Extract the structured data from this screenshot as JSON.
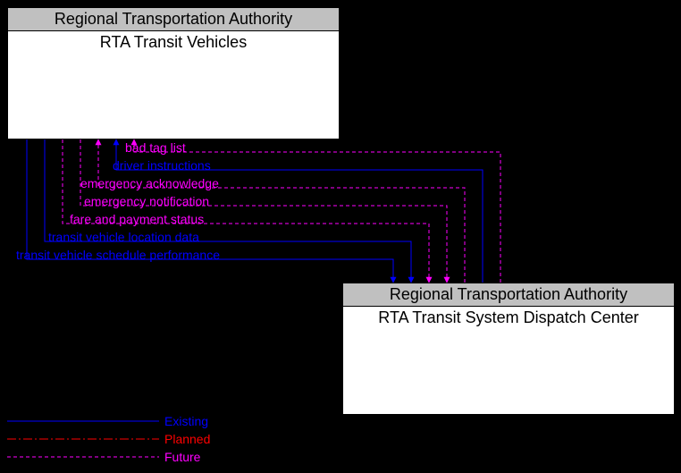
{
  "boxes": {
    "top": {
      "header": "Regional Transportation Authority",
      "title": "RTA Transit Vehicles"
    },
    "bottom": {
      "header": "Regional Transportation Authority",
      "title": "RTA Transit System Dispatch Center"
    }
  },
  "flows": [
    {
      "label": "bad tag list",
      "color": "magenta",
      "dir": "to_top"
    },
    {
      "label": "driver instructions",
      "color": "blue",
      "dir": "to_top"
    },
    {
      "label": "emergency acknowledge",
      "color": "magenta",
      "dir": "to_top"
    },
    {
      "label": "emergency notification",
      "color": "magenta",
      "dir": "to_bottom"
    },
    {
      "label": "fare and payment status",
      "color": "magenta",
      "dir": "to_bottom"
    },
    {
      "label": "transit vehicle location data",
      "color": "blue",
      "dir": "to_bottom"
    },
    {
      "label": "transit vehicle schedule performance",
      "color": "blue",
      "dir": "to_bottom"
    }
  ],
  "legend": {
    "existing": "Existing",
    "planned": "Planned",
    "future": "Future"
  },
  "colors": {
    "blue": "#0000ff",
    "magenta": "#ff00ff",
    "red": "#ff0000"
  }
}
